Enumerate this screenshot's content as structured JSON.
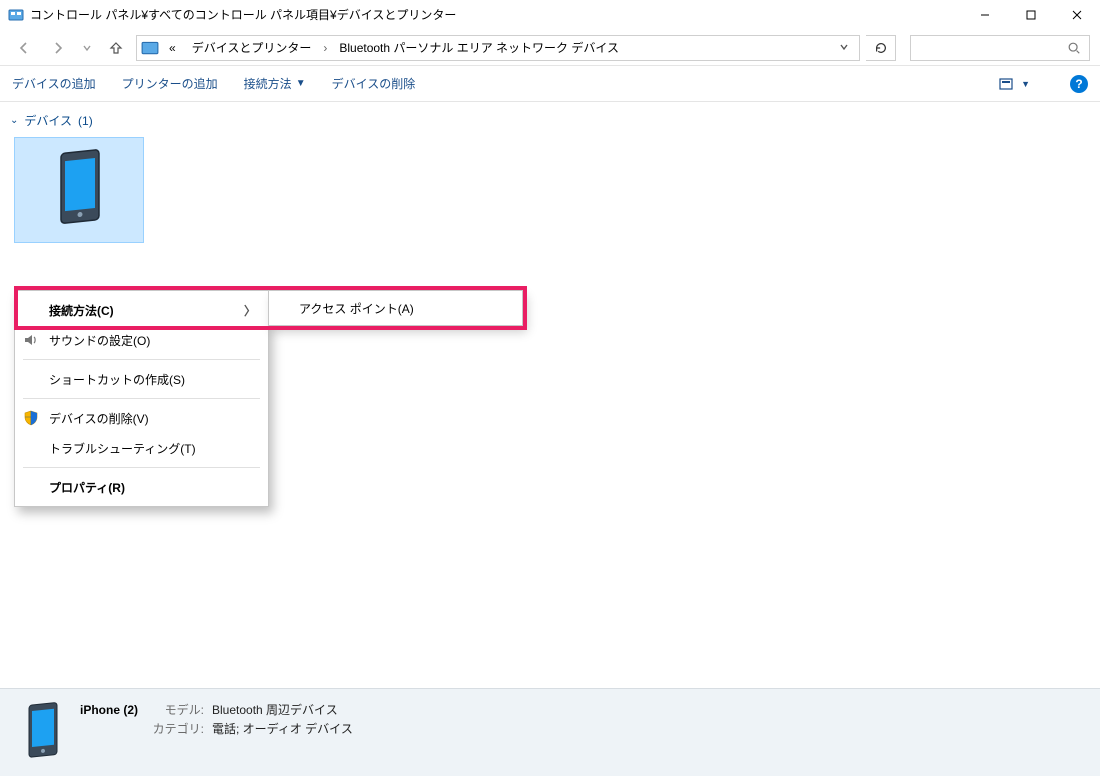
{
  "window": {
    "title": "コントロール パネル¥すべてのコントロール パネル項目¥デバイスとプリンター"
  },
  "breadcrumb": {
    "prefix": "«",
    "part1": "デバイスとプリンター",
    "part2": "Bluetooth パーソナル エリア ネットワーク デバイス"
  },
  "commands": {
    "add_device": "デバイスの追加",
    "add_printer": "プリンターの追加",
    "connect_using": "接続方法",
    "remove_device": "デバイスの削除"
  },
  "group": {
    "label": "デバイス",
    "count": "(1)"
  },
  "context_menu": {
    "connect_using": "接続方法(C)",
    "sound_settings": "サウンドの設定(O)",
    "create_shortcut": "ショートカットの作成(S)",
    "remove_device": "デバイスの削除(V)",
    "troubleshoot": "トラブルシューティング(T)",
    "properties": "プロパティ(R)"
  },
  "submenu": {
    "access_point": "アクセス ポイント(A)"
  },
  "details": {
    "name": "iPhone (2)",
    "model_label": "モデル:",
    "model_value": "Bluetooth 周辺デバイス",
    "category_label": "カテゴリ:",
    "category_value": "電話; オーディオ デバイス"
  }
}
